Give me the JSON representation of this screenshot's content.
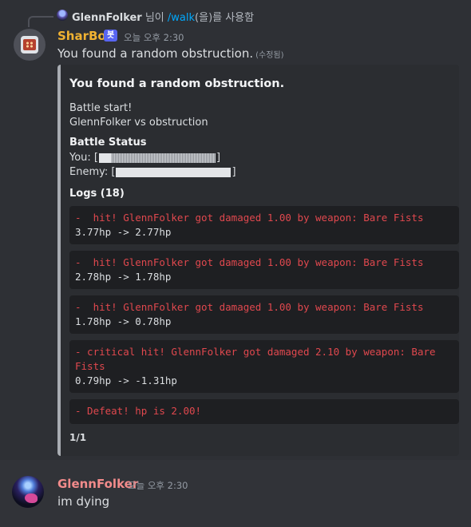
{
  "reply": {
    "username": "GlennFolker",
    "middle": " 님이 ",
    "command": "/walk",
    "suffix": "(을)를 사용함"
  },
  "bot_message": {
    "author": "SharBot",
    "badge": "봇",
    "timestamp": "오늘 오후 2:30",
    "text": "You found a random obstruction.",
    "edited_label": "(수정됨)"
  },
  "embed": {
    "title": "You found a random obstruction.",
    "description_line1": "Battle start!",
    "description_line2": "GlennFolker vs obstruction",
    "status_heading": "Battle Status",
    "you_label": "You: [",
    "you_hp_fraction": 0.1,
    "enemy_label": "Enemy: [",
    "enemy_hp_fraction": 1.0,
    "bar_close": "]",
    "logs_heading": "Logs (18)",
    "logs": [
      {
        "event": "-  hit! GlennFolker got damaged 1.00 by weapon: Bare Fists",
        "hp": "3.77hp -> 2.77hp"
      },
      {
        "event": "-  hit! GlennFolker got damaged 1.00 by weapon: Bare Fists",
        "hp": "2.78hp -> 1.78hp"
      },
      {
        "event": "-  hit! GlennFolker got damaged 1.00 by weapon: Bare Fists",
        "hp": "1.78hp -> 0.78hp"
      },
      {
        "event": "- critical hit! GlennFolker got damaged 2.10 by weapon: Bare Fists",
        "hp": "0.79hp -> -1.31hp"
      },
      {
        "event": "- Defeat! hp is 2.00!",
        "hp": ""
      }
    ],
    "pager": "1/1",
    "accent_color": "#a8acb2"
  },
  "user_message": {
    "author": "GlennFolker",
    "timestamp": "오늘 오후 2:30",
    "text": "im dying"
  },
  "colors": {
    "background": "#313338",
    "bot_name": "#f0b232",
    "user_name": "#f28b8b",
    "log_error": "#e0484e",
    "badge": "#5865f2"
  }
}
